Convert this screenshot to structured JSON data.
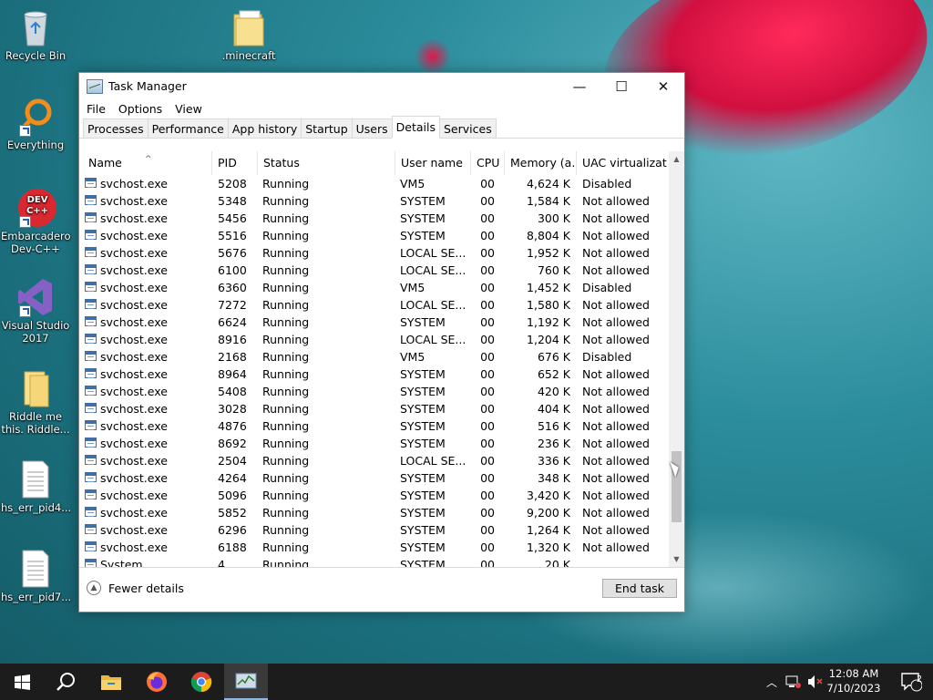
{
  "desktop": {
    "icons": [
      {
        "label": "Recycle Bin"
      },
      {
        "label": ".minecraft"
      },
      {
        "label": "Everything"
      },
      {
        "label": "Embarcadero Dev-C++"
      },
      {
        "label": "Visual Studio 2017"
      },
      {
        "label": "Riddle me this. Riddle..."
      },
      {
        "label": "hs_err_pid4..."
      },
      {
        "label": "hs_err_pid7..."
      }
    ],
    "devcpp_badge": "DEV C++"
  },
  "window": {
    "title": "Task Manager",
    "controls": {
      "minimize": "—",
      "maximize": "☐",
      "close": "✕"
    },
    "menu": [
      "File",
      "Options",
      "View"
    ],
    "tabs": [
      "Processes",
      "Performance",
      "App history",
      "Startup",
      "Users",
      "Details",
      "Services"
    ],
    "active_tab": "Details",
    "columns": [
      "Name",
      "PID",
      "Status",
      "User name",
      "CPU",
      "Memory (a...",
      "UAC virtualizat..."
    ],
    "rows": [
      {
        "name": "svchost.exe",
        "pid": "5208",
        "status": "Running",
        "user": "VM5",
        "cpu": "00",
        "mem": "4,624 K",
        "uac": "Disabled"
      },
      {
        "name": "svchost.exe",
        "pid": "5348",
        "status": "Running",
        "user": "SYSTEM",
        "cpu": "00",
        "mem": "1,584 K",
        "uac": "Not allowed"
      },
      {
        "name": "svchost.exe",
        "pid": "5456",
        "status": "Running",
        "user": "SYSTEM",
        "cpu": "00",
        "mem": "300 K",
        "uac": "Not allowed"
      },
      {
        "name": "svchost.exe",
        "pid": "5516",
        "status": "Running",
        "user": "SYSTEM",
        "cpu": "00",
        "mem": "8,804 K",
        "uac": "Not allowed"
      },
      {
        "name": "svchost.exe",
        "pid": "5676",
        "status": "Running",
        "user": "LOCAL SE...",
        "cpu": "00",
        "mem": "1,952 K",
        "uac": "Not allowed"
      },
      {
        "name": "svchost.exe",
        "pid": "6100",
        "status": "Running",
        "user": "LOCAL SE...",
        "cpu": "00",
        "mem": "760 K",
        "uac": "Not allowed"
      },
      {
        "name": "svchost.exe",
        "pid": "6360",
        "status": "Running",
        "user": "VM5",
        "cpu": "00",
        "mem": "1,452 K",
        "uac": "Disabled"
      },
      {
        "name": "svchost.exe",
        "pid": "7272",
        "status": "Running",
        "user": "LOCAL SE...",
        "cpu": "00",
        "mem": "1,580 K",
        "uac": "Not allowed"
      },
      {
        "name": "svchost.exe",
        "pid": "6624",
        "status": "Running",
        "user": "SYSTEM",
        "cpu": "00",
        "mem": "1,192 K",
        "uac": "Not allowed"
      },
      {
        "name": "svchost.exe",
        "pid": "8916",
        "status": "Running",
        "user": "LOCAL SE...",
        "cpu": "00",
        "mem": "1,204 K",
        "uac": "Not allowed"
      },
      {
        "name": "svchost.exe",
        "pid": "2168",
        "status": "Running",
        "user": "VM5",
        "cpu": "00",
        "mem": "676 K",
        "uac": "Disabled"
      },
      {
        "name": "svchost.exe",
        "pid": "8964",
        "status": "Running",
        "user": "SYSTEM",
        "cpu": "00",
        "mem": "652 K",
        "uac": "Not allowed"
      },
      {
        "name": "svchost.exe",
        "pid": "5408",
        "status": "Running",
        "user": "SYSTEM",
        "cpu": "00",
        "mem": "420 K",
        "uac": "Not allowed"
      },
      {
        "name": "svchost.exe",
        "pid": "3028",
        "status": "Running",
        "user": "SYSTEM",
        "cpu": "00",
        "mem": "404 K",
        "uac": "Not allowed"
      },
      {
        "name": "svchost.exe",
        "pid": "4876",
        "status": "Running",
        "user": "SYSTEM",
        "cpu": "00",
        "mem": "516 K",
        "uac": "Not allowed"
      },
      {
        "name": "svchost.exe",
        "pid": "8692",
        "status": "Running",
        "user": "SYSTEM",
        "cpu": "00",
        "mem": "236 K",
        "uac": "Not allowed"
      },
      {
        "name": "svchost.exe",
        "pid": "2504",
        "status": "Running",
        "user": "LOCAL SE...",
        "cpu": "00",
        "mem": "336 K",
        "uac": "Not allowed"
      },
      {
        "name": "svchost.exe",
        "pid": "4264",
        "status": "Running",
        "user": "SYSTEM",
        "cpu": "00",
        "mem": "348 K",
        "uac": "Not allowed"
      },
      {
        "name": "svchost.exe",
        "pid": "5096",
        "status": "Running",
        "user": "SYSTEM",
        "cpu": "00",
        "mem": "3,420 K",
        "uac": "Not allowed"
      },
      {
        "name": "svchost.exe",
        "pid": "5852",
        "status": "Running",
        "user": "SYSTEM",
        "cpu": "00",
        "mem": "9,200 K",
        "uac": "Not allowed"
      },
      {
        "name": "svchost.exe",
        "pid": "6296",
        "status": "Running",
        "user": "SYSTEM",
        "cpu": "00",
        "mem": "1,264 K",
        "uac": "Not allowed"
      },
      {
        "name": "svchost.exe",
        "pid": "6188",
        "status": "Running",
        "user": "SYSTEM",
        "cpu": "00",
        "mem": "1,320 K",
        "uac": "Not allowed"
      },
      {
        "name": "System",
        "pid": "4",
        "status": "Running",
        "user": "SYSTEM",
        "cpu": "00",
        "mem": "20 K",
        "uac": ""
      }
    ],
    "fewer_details": "Fewer details",
    "end_task": "End task"
  },
  "taskbar": {
    "apps": [
      "start-icon",
      "search-icon",
      "file-explorer-icon",
      "firefox-icon",
      "chrome-icon",
      "task-manager-icon"
    ],
    "active_app": "task-manager-icon",
    "clock_time": "12:08 AM",
    "clock_date": "7/10/2023",
    "notification_count": "2"
  },
  "colors": {
    "accent": "#8fb8e0",
    "taskbar": "#1c1c1c",
    "desktop": "#2c8d9c"
  }
}
